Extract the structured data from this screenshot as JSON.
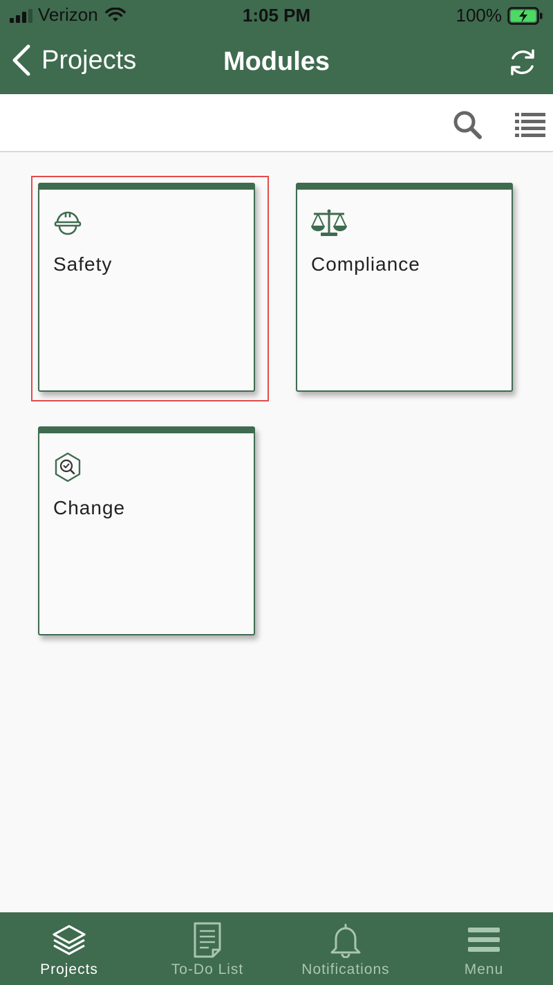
{
  "status_bar": {
    "carrier": "Verizon",
    "time": "1:05 PM",
    "battery": "100%"
  },
  "nav": {
    "back_label": "Projects",
    "title": "Modules"
  },
  "modules": [
    {
      "label": "Safety",
      "icon": "hard-hat-icon",
      "selected": true
    },
    {
      "label": "Compliance",
      "icon": "scales-icon",
      "selected": false
    },
    {
      "label": "Change",
      "icon": "inspect-badge-icon",
      "selected": false
    }
  ],
  "tabs": [
    {
      "label": "Projects",
      "icon": "layers-icon",
      "active": true
    },
    {
      "label": "To-Do List",
      "icon": "document-icon",
      "active": false
    },
    {
      "label": "Notifications",
      "icon": "bell-icon",
      "active": false
    },
    {
      "label": "Menu",
      "icon": "hamburger-icon",
      "active": false
    }
  ],
  "colors": {
    "brand_green": "#3f6b4f",
    "inactive_tab": "#a9c6b1",
    "selection_red": "#e14b4b",
    "battery_green": "#4cd964"
  }
}
